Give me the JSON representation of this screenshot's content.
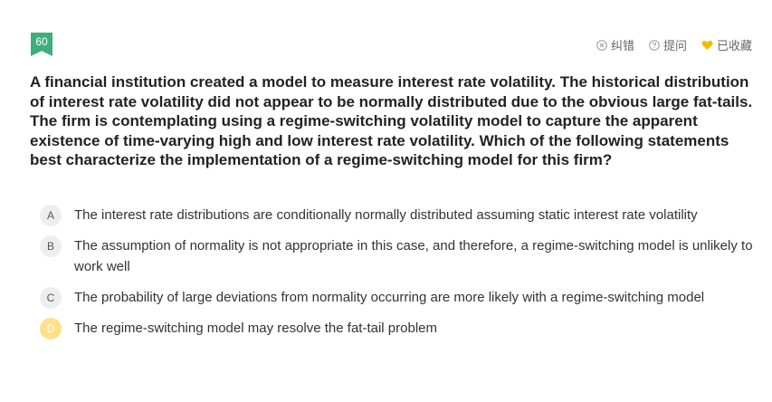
{
  "question": {
    "number": "60",
    "text": "A financial institution created a model to measure interest rate volatility. The historical distribution of interest rate volatility did not appear to be normally distributed due to the obvious large fat-tails. The firm is contemplating using a regime-switching volatility model to capture the apparent existence of time-varying high and low interest rate volatility. Which of the following statements best characterize the implementation of a regime-switching model for this firm?"
  },
  "toolbar": {
    "correct_label": "纠错",
    "ask_label": "提问",
    "favorite_label": "已收藏",
    "favorite_color": "#f5b800"
  },
  "options": [
    {
      "letter": "A",
      "text": "The interest rate distributions are conditionally normally distributed assuming static interest rate volatility"
    },
    {
      "letter": "B",
      "text": "The assumption of normality is not appropriate in this case, and therefore, a regime-switching model is unlikely to work well"
    },
    {
      "letter": "C",
      "text": "The probability of large deviations from normality occurring are more likely with a regime-switching model"
    },
    {
      "letter": "D",
      "text": "The regime-switching model may resolve the fat-tail problem",
      "selected": true
    }
  ]
}
